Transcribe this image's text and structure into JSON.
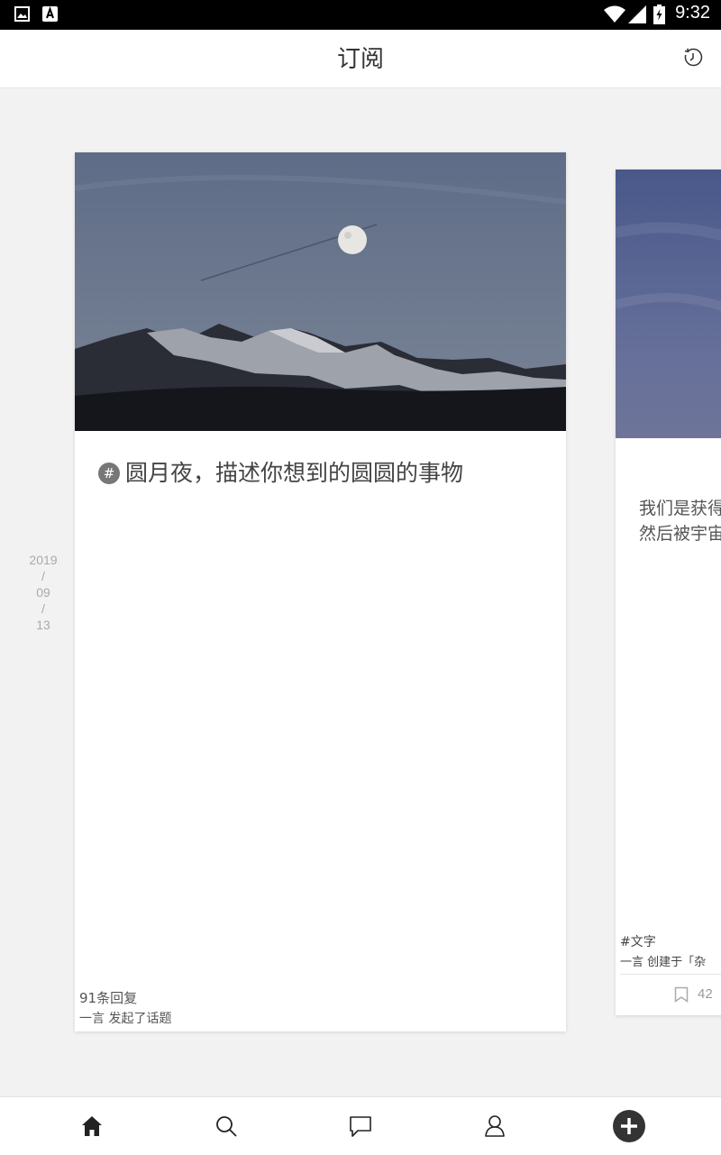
{
  "status_bar": {
    "time": "9:32",
    "icons": [
      "image-icon",
      "app-icon",
      "wifi-icon",
      "signal-icon",
      "battery-icon"
    ]
  },
  "header": {
    "title": "订阅",
    "right_icon": "history-icon"
  },
  "date": {
    "year": "2019",
    "sep1": "/",
    "month": "09",
    "sep2": "/",
    "day": "13"
  },
  "topic_card": {
    "image": "moon-over-mountains",
    "hash": "#",
    "title": "圆月夜，描述你想到的圆圆的事物",
    "replies": "91条回复",
    "creator": "一言 发起了话题"
  },
  "next_card": {
    "line1": "我们是获得",
    "line2": "然后被宇宙",
    "tag": "#文字",
    "meta": "一言 创建于「杂",
    "bookmark_count": "42"
  },
  "bottom_nav": [
    {
      "icon": "home-icon"
    },
    {
      "icon": "search-icon"
    },
    {
      "icon": "chat-icon"
    },
    {
      "icon": "user-icon"
    },
    {
      "icon": "add-icon"
    }
  ],
  "colors": {
    "accent": "#333333",
    "background": "#f2f2f2"
  }
}
